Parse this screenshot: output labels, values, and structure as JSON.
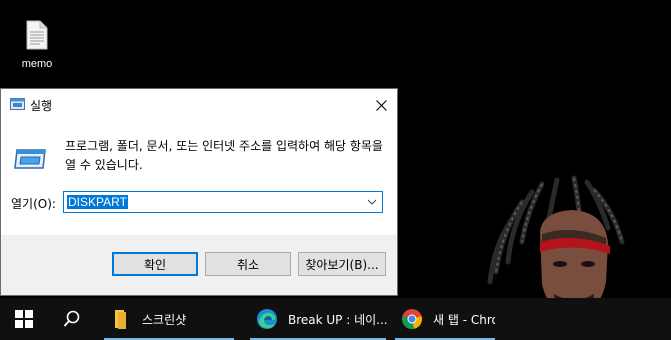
{
  "desktop": {
    "icons": [
      {
        "label": "memo",
        "icon": "text-file-icon"
      }
    ]
  },
  "run_dialog": {
    "title": "실행",
    "description": "프로그램, 폴더, 문서, 또는 인터넷 주소를 입력하여 해당 항목을 열 수 있습니다.",
    "open_label": "열기(O):",
    "open_value": "DISKPART",
    "buttons": {
      "ok": "확인",
      "cancel": "취소",
      "browse": "찾아보기(B)..."
    }
  },
  "taskbar": {
    "items": [
      {
        "label": "스크린샷",
        "icon": "folder-icon"
      },
      {
        "label": "Break UP : 네이...",
        "icon": "edge-icon"
      },
      {
        "label": "새 탭 - Chrome",
        "icon": "chrome-icon"
      }
    ]
  },
  "colors": {
    "accent": "#0078d7",
    "taskbar_bg": "#101010",
    "dialog_bg": "#f0f0f0"
  }
}
